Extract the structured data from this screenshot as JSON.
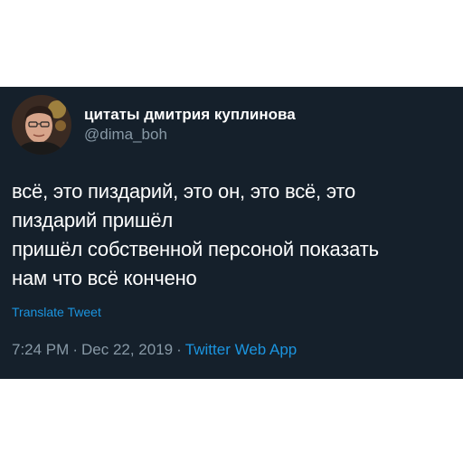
{
  "tweet": {
    "display_name": "цитаты дмитрия куплинова",
    "handle": "@dima_boh",
    "lines": [
      "всё, это пиздарий, это он, это всё, это",
      "пиздарий пришёл",
      "пришёл собственной персоной показать",
      "нам что всё кончено"
    ],
    "translate_label": "Translate Tweet",
    "time": "7:24 PM",
    "separator": "·",
    "date": "Dec 22, 2019",
    "source": "Twitter Web App"
  },
  "colors": {
    "card_background": "#15202b",
    "text_primary": "#ffffff",
    "text_secondary": "#8899a6",
    "accent": "#1b95e0"
  },
  "icons": {
    "avatar": "profile-photo"
  }
}
